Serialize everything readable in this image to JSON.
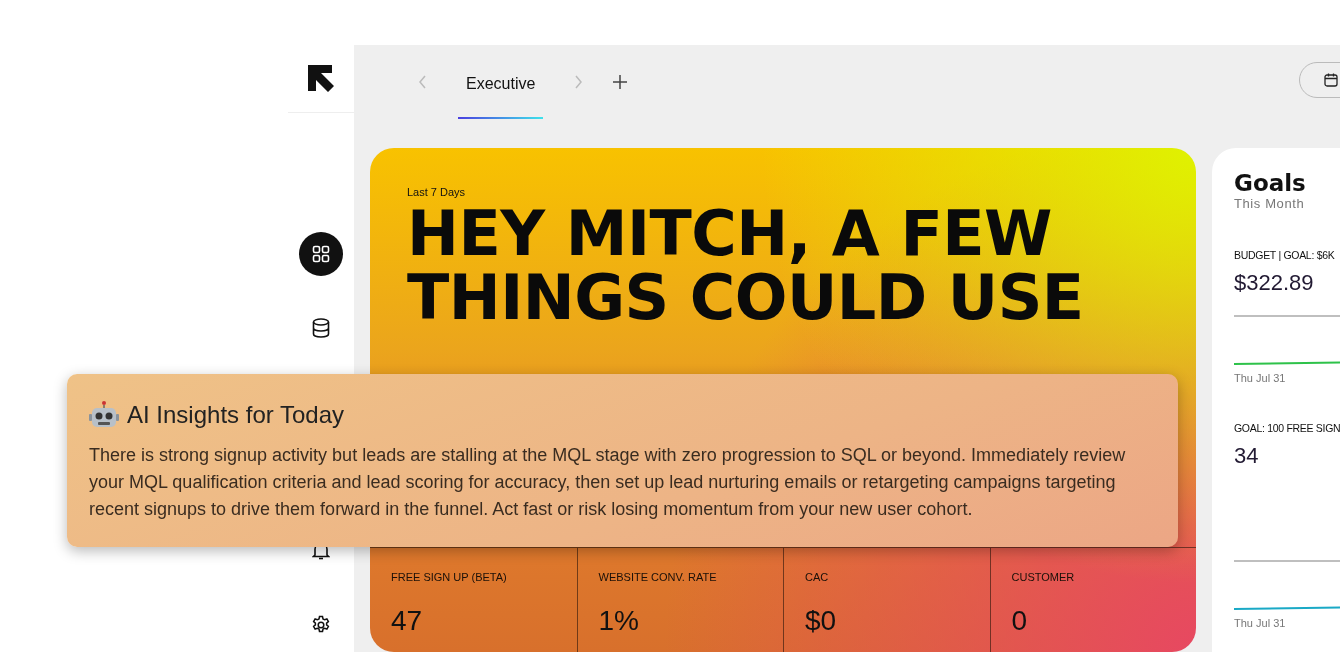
{
  "sidebar": {
    "items": [
      {
        "kind": "dashboard",
        "selected": true
      },
      {
        "kind": "database",
        "selected": false
      },
      {
        "kind": "alerts",
        "selected": false
      },
      {
        "kind": "settings",
        "selected": false
      }
    ]
  },
  "tabs": [
    {
      "label": "Executive",
      "selected": true
    }
  ],
  "hero": {
    "period": "Last 7 Days",
    "headline": "HEY MITCH, A FEW THINGS COULD USE",
    "stats": [
      {
        "label": "FREE SIGN UP (BETA)",
        "value": "47"
      },
      {
        "label": "WEBSITE CONV. RATE",
        "value": "1%"
      },
      {
        "label": "CAC",
        "value": "$0"
      },
      {
        "label": "CUSTOMER",
        "value": "0"
      }
    ]
  },
  "insights": {
    "title": "AI Insights for Today",
    "body": "There is strong signup activity but leads are stalling at the MQL stage with zero progression to SQL or beyond. Immediately review your MQL qualification criteria and lead scoring for accuracy, then set up lead nurturing emails or retargeting campaigns targeting recent signups to drive them forward in the funnel. Act fast or risk losing momentum from your new user cohort."
  },
  "goals": {
    "title": "Goals",
    "subtitle": "This Month",
    "items": [
      {
        "label": "BUDGET | GOAL: $6K",
        "value": "$322.89",
        "date": "Thu Jul 31",
        "color": "#2ec24a"
      },
      {
        "label": "GOAL: 100 FREE SIGN",
        "value": "34",
        "date": "Thu Jul 31",
        "color": "#1aa9c6"
      }
    ]
  }
}
